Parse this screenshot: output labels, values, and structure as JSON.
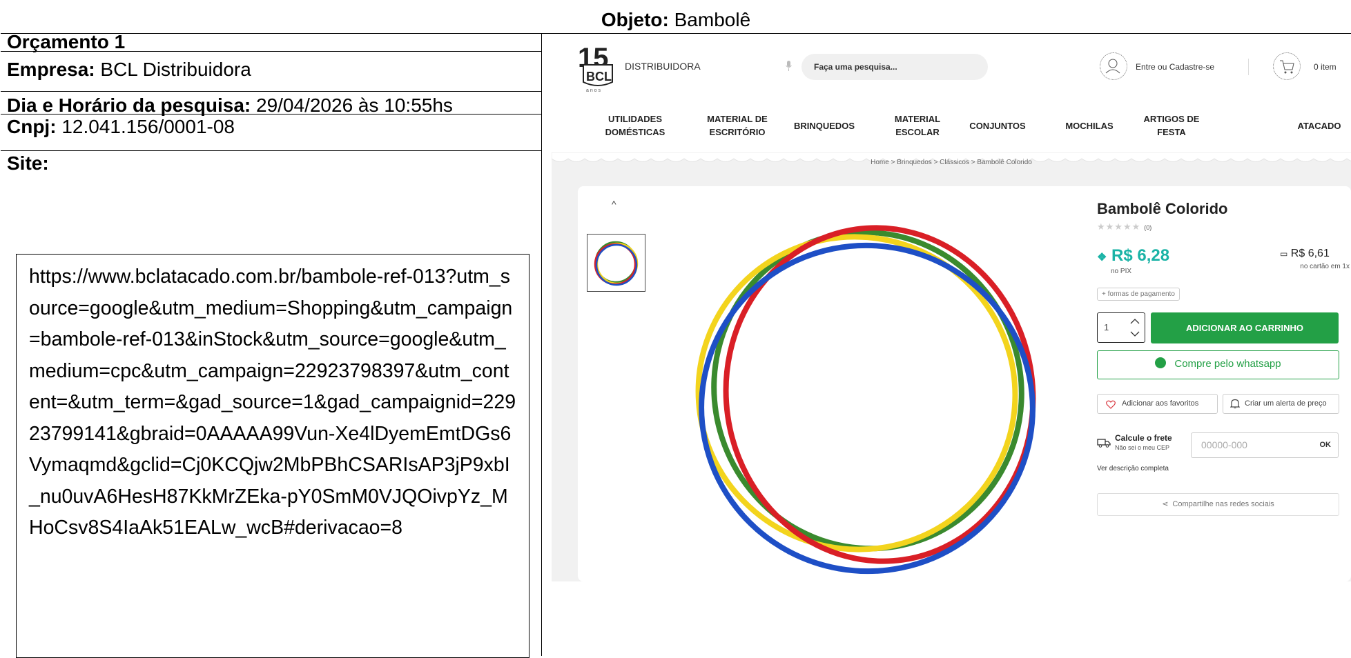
{
  "header": {
    "label": "Objeto:",
    "value": "Bambolê"
  },
  "budget": {
    "title": "Orçamento 1",
    "empresa_label": "Empresa:",
    "empresa_value": "BCL Distribuidora",
    "data_label": "Dia e Horário da pesquisa:",
    "data_value": "29/04/2026 às 10:55hs",
    "cnpj_label": "Cnpj:",
    "cnpj_value": "12.041.156/0001-08",
    "site_label": "Site:",
    "url": "https://www.bclatacado.com.br/bambole-ref-013?utm_source=google&utm_medium=Shopping&utm_campaign=bambole-ref-013&inStock&utm_source=google&utm_medium=cpc&utm_campaign=22923798397&utm_content=&utm_term=&gad_source=1&gad_campaignid=22923799141&gbraid=0AAAAA99Vun-Xe4lDyemEmtDGs6Vymaqmd&gclid=Cj0KCQjw2MbPBhCSARIsAP3jP9xbI_nu0uvA6HesH87KkMrZEka-pY0SmM0VJQOivpYz_MHoCsv8S4IaAk51EALw_wcB#derivacao=8"
  },
  "site": {
    "logo_text": "DISTRIBUIDORA",
    "search_placeholder": "Faça uma pesquisa...",
    "login": "Entre ou Cadastre-se",
    "cart": "0 item",
    "nav": [
      {
        "l1": "UTILIDADES",
        "l2": "DOMÉSTICAS"
      },
      {
        "l1": "MATERIAL DE",
        "l2": "ESCRITÓRIO"
      },
      {
        "l1": "BRINQUEDOS",
        "l2": ""
      },
      {
        "l1": "MATERIAL",
        "l2": "ESCOLAR"
      },
      {
        "l1": "CONJUNTOS",
        "l2": ""
      },
      {
        "l1": "MOCHILAS",
        "l2": ""
      },
      {
        "l1": "ARTIGOS DE",
        "l2": "FESTA"
      },
      {
        "l1": "ATACADO",
        "l2": ""
      }
    ],
    "breadcrumb": "Home > Brinquedos > Clássicos > Bambolê Colorido",
    "product_name": "Bambolê Colorido",
    "stars": "★★★★★",
    "reviews": "(0)",
    "rating": 0,
    "price_pix": "R$ 6,28",
    "pix_label": "no PIX",
    "price_card": "R$ 6,61",
    "card_label": "no cartão em 1x",
    "payment_link": "+ formas de pagamento",
    "qty": "1",
    "add_to_cart": "ADICIONAR AO CARRINHO",
    "whatsapp": "Compre pelo whatsapp",
    "favorites": "Adicionar aos favoritos",
    "price_alert": "Criar um alerta de preço",
    "freight_title": "Calcule o frete",
    "freight_sub": "Não sei o meu CEP",
    "cep_placeholder": "00000-000",
    "cep_ok": "OK",
    "description_link": "Ver descrição completa",
    "share": "Compartilhe nas redes sociais",
    "colors": {
      "accent_green": "#23a046",
      "price_teal": "#1ab3a6"
    }
  }
}
